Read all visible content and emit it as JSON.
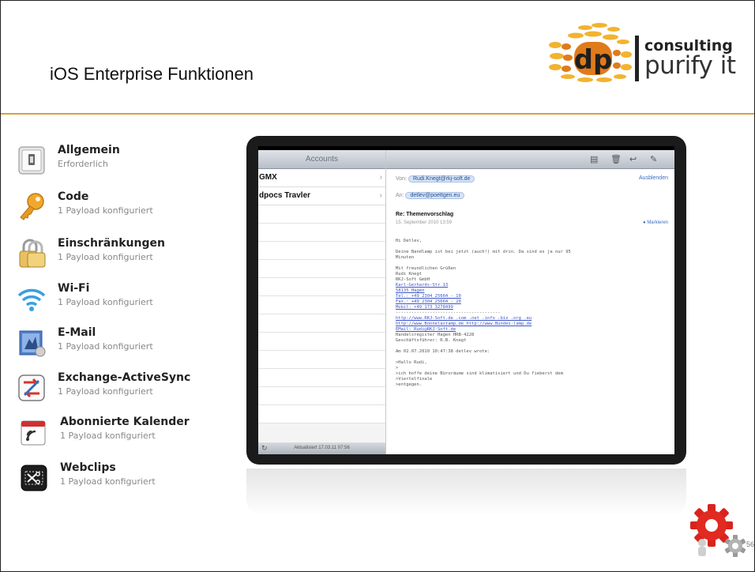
{
  "slide": {
    "title": "iOS Enterprise Funktionen",
    "page_number": "56",
    "accent_color": "#d6a23a"
  },
  "logo": {
    "letters": "dp",
    "line1": "consulting",
    "line2": "purify it",
    "colors": [
      "#e07b1a",
      "#f2b330",
      "#222222"
    ]
  },
  "payloads": [
    {
      "title": "Allgemein",
      "subtitle": "Erforderlich",
      "icon": "general-settings-icon"
    },
    {
      "title": "Code",
      "subtitle": "1 Payload konfiguriert",
      "icon": "key-icon"
    },
    {
      "title": "Einschränkungen",
      "subtitle": "1 Payload konfiguriert",
      "icon": "padlock-icon"
    },
    {
      "title": "Wi-Fi",
      "subtitle": "1 Payload konfiguriert",
      "icon": "wifi-icon"
    },
    {
      "title": "E-Mail",
      "subtitle": "1 Payload konfiguriert",
      "icon": "mail-stamp-icon"
    },
    {
      "title": "Exchange-ActiveSync",
      "subtitle": "1 Payload konfiguriert",
      "icon": "exchange-icon"
    },
    {
      "title": "Abonnierte Kalender",
      "subtitle": "1 Payload konfiguriert",
      "icon": "subscribed-calendar-icon"
    },
    {
      "title": "Webclips",
      "subtitle": "1 Payload konfiguriert",
      "icon": "webclip-icon"
    }
  ],
  "ipad": {
    "sidebar": {
      "header": "Accounts",
      "accounts": [
        "GMX",
        "dpocs Travler"
      ],
      "footer": "Aktualisiert 17.03.11 07:56"
    },
    "mail": {
      "hide_label": "Ausblenden",
      "from_label": "Von:",
      "from_value": "Rudi.Knegt@rkj-soft.de",
      "to_label": "An:",
      "to_value": "detlev@poettgen.eu",
      "subject": "Re: Themenvorschlag",
      "date": "15. September 2010 13:59",
      "mark_label": "Markieren",
      "body_lines": [
        {
          "text": "Hi Detlev,",
          "link": false
        },
        {
          "text": "",
          "link": false
        },
        {
          "text": "Deine Bandlamp ist bei jetzt (auch!) mit drin. Da sind es ja nur 95",
          "link": false
        },
        {
          "text": "Minuten",
          "link": false
        },
        {
          "text": "",
          "link": false
        },
        {
          "text": "Mit freundlichen Grüßen",
          "link": false
        },
        {
          "text": "Rudi Knegt",
          "link": false
        },
        {
          "text": "RKJ-Soft GmbH",
          "link": false
        },
        {
          "text": "Karl-Gerhards-Str 13",
          "link": true
        },
        {
          "text": "58135 Hagen",
          "link": true
        },
        {
          "text": "Tel.: +49 2304 25664 - 10",
          "link": true
        },
        {
          "text": "Fax.: +49 2304 25664 - 20",
          "link": true
        },
        {
          "text": "Mobil: +49 173 3278499",
          "link": true
        },
        {
          "text": "----------------------------------------",
          "link": false
        },
        {
          "text": "http://www.RKJ-Soft.de .com .net .info .biz .org .eu",
          "link": true
        },
        {
          "text": "http://www.Bonnelastamp.de http://www.Bundes-lamp.de",
          "link": true
        },
        {
          "text": "EMail: Rudi@RKJ-Soft.de",
          "link": true
        },
        {
          "text": "Handelsregister Hagen HRB-4228",
          "link": false
        },
        {
          "text": "Geschäftsführer: R.B. Knegt",
          "link": false
        },
        {
          "text": "",
          "link": false
        },
        {
          "text": "Am 02.07.2010 10:47:38 detlev wrote:",
          "link": false
        },
        {
          "text": "",
          "link": false
        },
        {
          "text": ">Hallo Rudi,",
          "link": false
        },
        {
          "text": ">",
          "link": false
        },
        {
          "text": ">ich hoffe deine Büroräume sind klimatisiert und Du fieberst dem",
          "link": false
        },
        {
          "text": ">Viertelfinale",
          "link": false
        },
        {
          "text": ">entgegen.",
          "link": false
        }
      ]
    }
  }
}
